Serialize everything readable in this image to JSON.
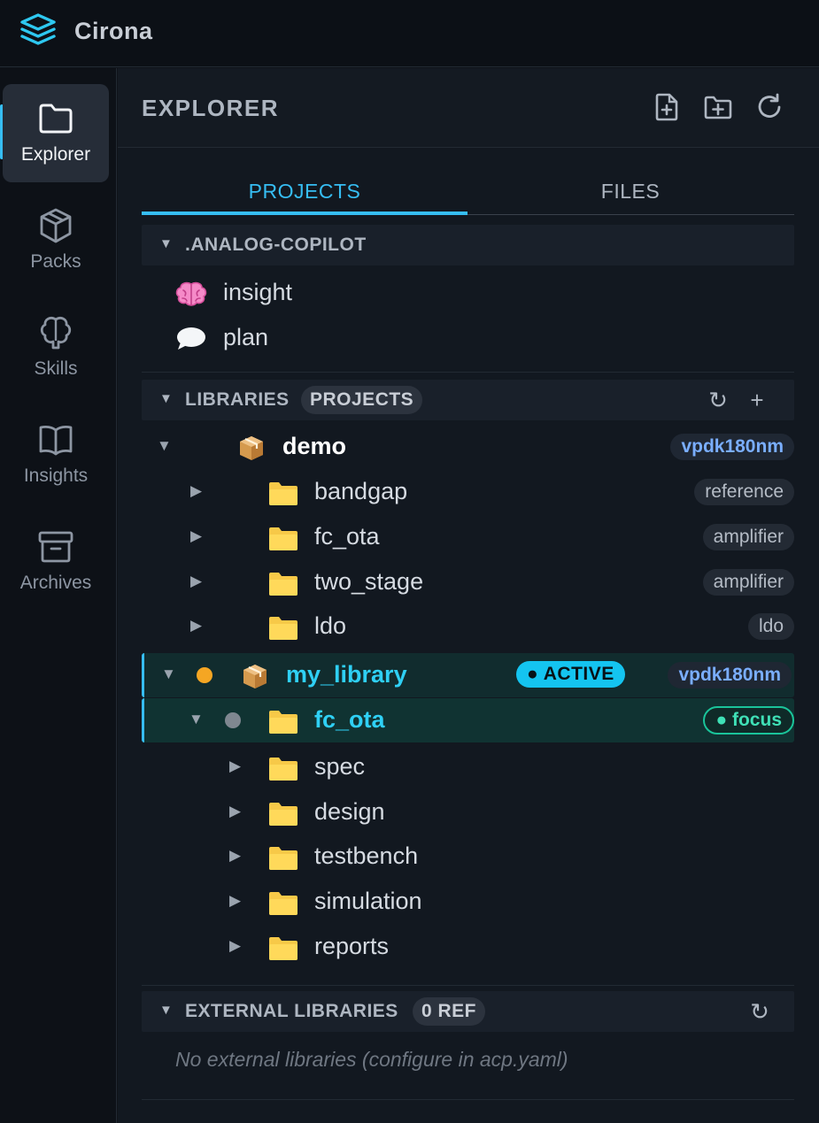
{
  "app": {
    "title": "Cirona"
  },
  "rail": {
    "items": [
      {
        "label": "Explorer",
        "icon": "folder-icon",
        "active": true
      },
      {
        "label": "Packs",
        "icon": "package-icon"
      },
      {
        "label": "Skills",
        "icon": "brain-icon"
      },
      {
        "label": "Insights",
        "icon": "book-icon"
      },
      {
        "label": "Archives",
        "icon": "archive-icon"
      }
    ]
  },
  "panel": {
    "title": "EXPLORER",
    "actions": [
      "new-file-icon",
      "new-folder-icon",
      "refresh-icon"
    ]
  },
  "tabs": [
    {
      "label": "PROJECTS",
      "active": true
    },
    {
      "label": "FILES",
      "active": false
    }
  ],
  "copilot": {
    "title": ".ANALOG-COPILOT",
    "items": [
      {
        "label": "insight",
        "icon": "brain-emoji-icon"
      },
      {
        "label": "plan",
        "icon": "speech-bubble-icon"
      }
    ]
  },
  "libraries": {
    "title": "LIBRARIES",
    "chip": "PROJECTS",
    "refresh_glyph": "↻",
    "add_glyph": "+",
    "demo": {
      "name": "demo",
      "pdk": "vpdk180nm",
      "projects": [
        {
          "name": "bandgap",
          "tag": "reference"
        },
        {
          "name": "fc_ota",
          "tag": "amplifier"
        },
        {
          "name": "two_stage",
          "tag": "amplifier"
        },
        {
          "name": "ldo",
          "tag": "ldo"
        }
      ]
    },
    "my_library": {
      "name": "my_library",
      "badge": "● ACTIVE",
      "pdk": "vpdk180nm",
      "focus_project": {
        "name": "fc_ota",
        "badge": "● focus",
        "folders": [
          "spec",
          "design",
          "testbench",
          "simulation",
          "reports"
        ]
      }
    }
  },
  "external": {
    "title": "EXTERNAL LIBRARIES",
    "chip": "0 REF",
    "refresh_glyph": "↻",
    "empty_text": "No external libraries (configure in acp.yaml)"
  },
  "colors": {
    "accent": "#36bdf3",
    "active_badge": "#14c4f0",
    "focus_green": "#1ac49a",
    "folder_yellow": "#f7c948",
    "dot_orange": "#f5a623",
    "pdk_blue": "#7aaeff"
  }
}
